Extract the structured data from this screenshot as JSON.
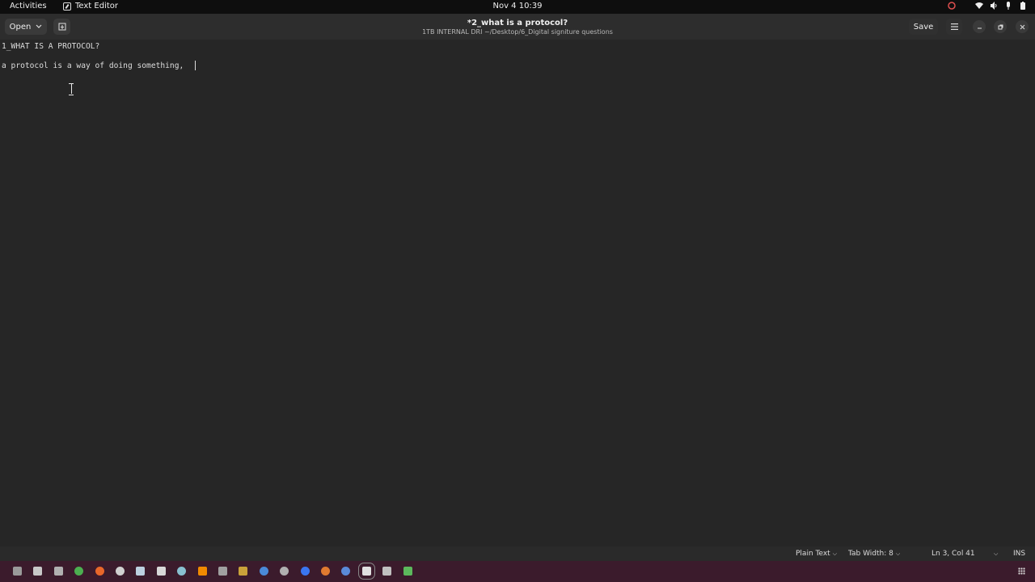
{
  "topbar": {
    "activities": "Activities",
    "app_name": "Text Editor",
    "clock": "Nov 4  10:39"
  },
  "header": {
    "open_label": "Open",
    "save_label": "Save",
    "title": "*2_what is a protocol?",
    "subtitle": "1TB INTERNAL DRI ~/Desktop/6_Digital signiture questions"
  },
  "editor": {
    "lines": [
      "1_WHAT IS A PROTOCOL?",
      "",
      "a protocol is a way of doing something, "
    ]
  },
  "statusbar": {
    "language": "Plain Text",
    "tab_width": "Tab Width: 8",
    "position": "Ln 3, Col 41",
    "mode": "INS"
  },
  "dock": {
    "icons": [
      {
        "name": "files-icon",
        "color": "#9a9a9a"
      },
      {
        "name": "terminal-icon",
        "color": "#c8c8c8"
      },
      {
        "name": "folder-icon",
        "color": "#b0b0b0"
      },
      {
        "name": "chrome-icon",
        "color": "#4caf50"
      },
      {
        "name": "firefox-icon",
        "color": "#e8672a"
      },
      {
        "name": "settings-icon",
        "color": "#d0d0d0"
      },
      {
        "name": "steam-icon",
        "color": "#bcd0e0"
      },
      {
        "name": "app-icon",
        "color": "#d8d8d8"
      },
      {
        "name": "software-icon",
        "color": "#88c0d0"
      },
      {
        "name": "vlc-icon",
        "color": "#f08a00"
      },
      {
        "name": "tools-icon",
        "color": "#a0a0a0"
      },
      {
        "name": "paint-icon",
        "color": "#c9a23a"
      },
      {
        "name": "blender-icon",
        "color": "#4a8ad8"
      },
      {
        "name": "chat-icon",
        "color": "#b0b0b0"
      },
      {
        "name": "signal-icon",
        "color": "#3a76f0"
      },
      {
        "name": "game-icon",
        "color": "#e07a30"
      },
      {
        "name": "globe-icon",
        "color": "#5a8ad8"
      },
      {
        "name": "text-editor-icon",
        "color": "#e0e0e0"
      },
      {
        "name": "document-icon",
        "color": "#c0c0c0"
      },
      {
        "name": "spreadsheet-icon",
        "color": "#5cb85c"
      }
    ]
  }
}
